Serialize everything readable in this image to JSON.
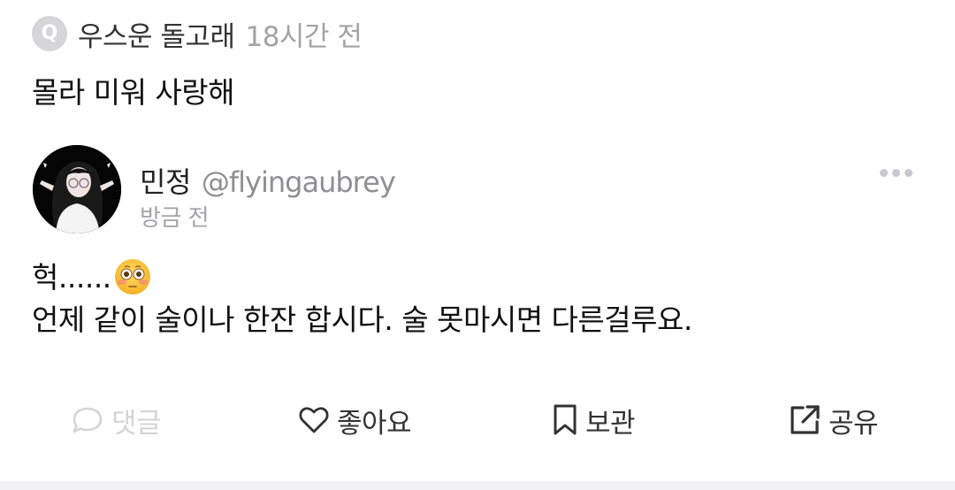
{
  "question": {
    "badge_letter": "Q",
    "author": "우스운 돌고래",
    "time": "18시간 전",
    "text": "몰라 미워 사랑해"
  },
  "answer": {
    "user_name": "민정",
    "handle": "@flyingaubrey",
    "time": "방금 전",
    "body_line1": "헉......",
    "emoji": "flushed-face",
    "body_line2": "언제 같이 술이나 한잔 합시다. 술 못마시면 다른걸루요."
  },
  "actions": {
    "comment_label": "댓글",
    "like_label": "좋아요",
    "save_label": "보관",
    "share_label": "공유"
  },
  "colors": {
    "muted_text": "#a3a3a8",
    "disabled": "#d4d4d8",
    "primary_text": "#111111"
  },
  "icons": [
    "q-badge",
    "more-icon",
    "comment-icon",
    "heart-icon",
    "bookmark-icon",
    "share-icon",
    "flushed-face-emoji"
  ]
}
